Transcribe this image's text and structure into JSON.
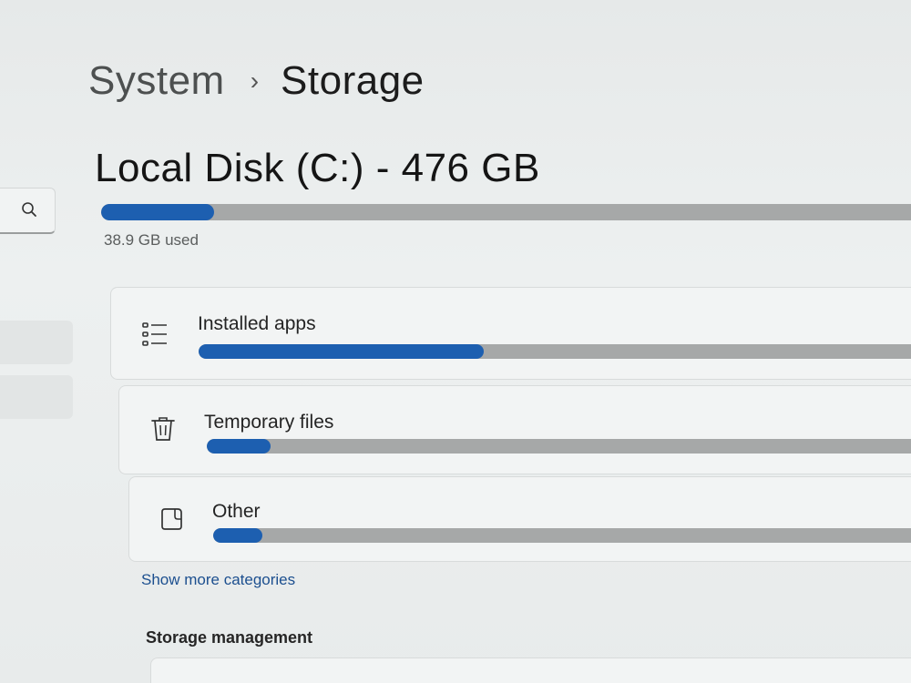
{
  "breadcrumb": {
    "parent": "System",
    "separator": "›",
    "current": "Storage"
  },
  "disk": {
    "title": "Local Disk (C:) - 476 GB",
    "used_label": "38.9 GB used",
    "used_fraction": 0.14
  },
  "categories": [
    {
      "label": "Installed apps",
      "icon": "list-icon",
      "fraction": 0.4
    },
    {
      "label": "Temporary files",
      "icon": "trash-icon",
      "fraction": 0.09
    },
    {
      "label": "Other",
      "icon": "other-icon",
      "fraction": 0.07
    }
  ],
  "show_more_label": "Show more categories",
  "storage_management": {
    "heading": "Storage management"
  },
  "colors": {
    "accent": "#1d5fb0",
    "bar_track": "#a6a8a8",
    "link": "#1c4f8f"
  }
}
